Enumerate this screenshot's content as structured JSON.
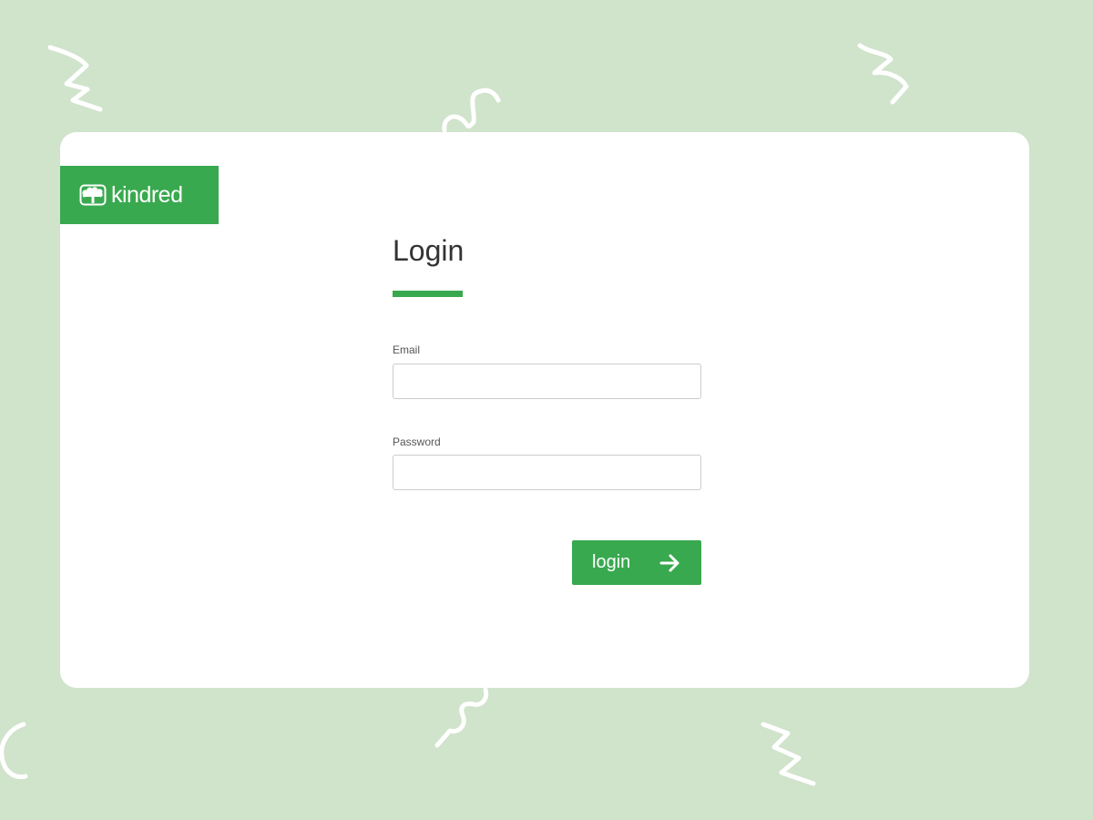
{
  "brand": {
    "name": "kindred",
    "icon": "tree-icon",
    "color": "#39a94f"
  },
  "login_form": {
    "title": "Login",
    "email_label": "Email",
    "email_value": "",
    "password_label": "Password",
    "password_value": "",
    "submit_label": "login",
    "submit_icon": "arrow-right-icon"
  },
  "colors": {
    "background": "#d0e3cb",
    "card": "#ffffff",
    "accent": "#39a94f",
    "squiggle": "#ffffff"
  }
}
